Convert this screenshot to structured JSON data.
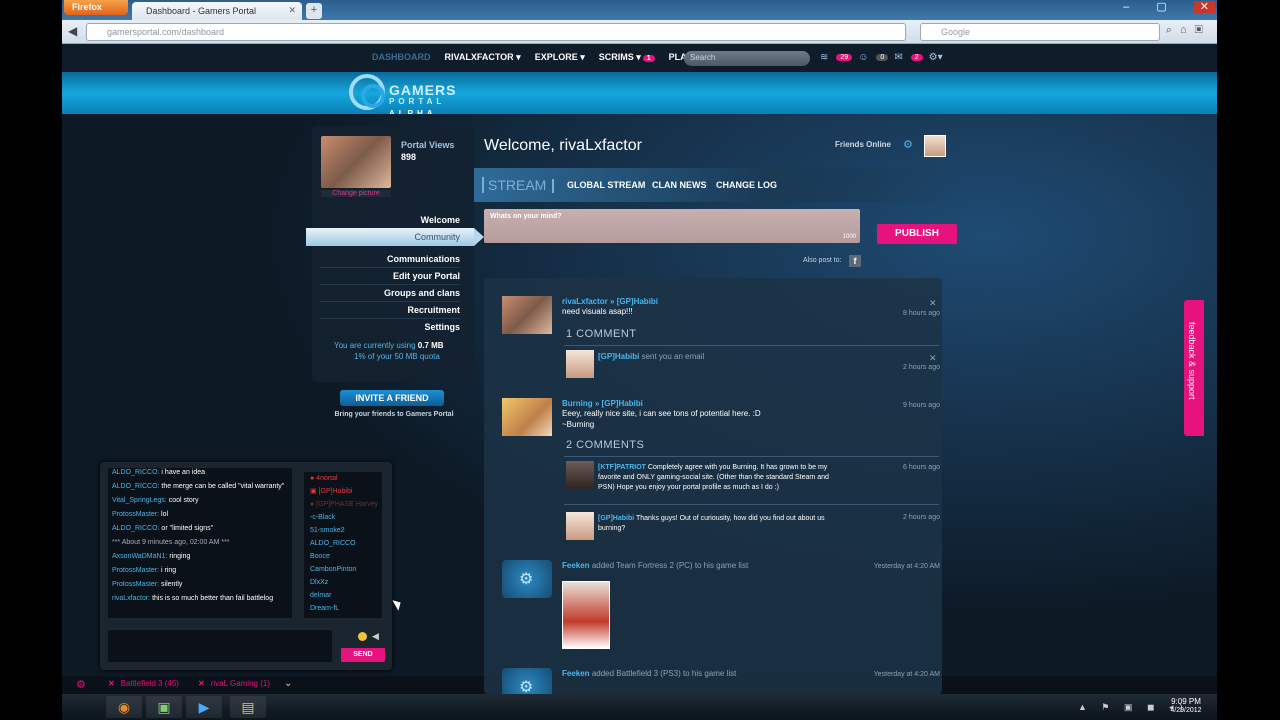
{
  "browser": {
    "app_button": "Firefox",
    "tab_title": "Dashboard - Gamers Portal",
    "new_tab": "+",
    "url": "gamersportal.com/dashboard",
    "search_placeholder": "Google",
    "win_controls": "–  ▢",
    "close": "✕"
  },
  "site_nav": {
    "dashboard": "DASHBOARD",
    "user": "RIVALXFACTOR ▾",
    "explore": "EXPLORE ▾",
    "scrims": "SCRIMS ▾",
    "scrims_badge": "1",
    "play": "PLAY",
    "search_placeholder": "Search",
    "feed_badge": "29",
    "friends_badge": "0",
    "mail_badge": "2"
  },
  "logo": {
    "line1": "GAMERS",
    "line2": "PORTAL",
    "line3": "ALPHA"
  },
  "profile": {
    "views_label": "Portal Views",
    "views_value": "898",
    "change_picture": "Change picture"
  },
  "menu": {
    "welcome": "Welcome",
    "community": "Community",
    "communications": "Communications",
    "edit_portal": "Edit your Portal",
    "groups": "Groups and clans",
    "recruitment": "Recruitment",
    "settings": "Settings"
  },
  "quota": {
    "line1_pre": "You are currently using",
    "line1_val": "0.7 MB",
    "line2_pct": "1%",
    "line2_post": "of your 50 MB quota"
  },
  "invite": {
    "button": "INVITE A FRIEND",
    "sub": "Bring your friends to Gamers Portal"
  },
  "chat": {
    "messages": [
      {
        "user": "ALDO_RICCO:",
        "text": "i have an idea"
      },
      {
        "user": "ALDO_RICCO:",
        "text": "the merge can be called \"vital warranty\""
      },
      {
        "user": "Vital_SpringLegs:",
        "text": "cool story"
      },
      {
        "user": "ProtossMaster:",
        "text": "lol"
      },
      {
        "user": "ALDO_RICCO:",
        "text": "or \"limited signs\""
      },
      {
        "user": "",
        "text": "*** About 9 minutes ago, 02:00 AM ***"
      },
      {
        "user": "AxsonWaDMaN1:",
        "text": "ringing"
      },
      {
        "user": "ProtossMaster:",
        "text": "i ring"
      },
      {
        "user": "ProtossMaster:",
        "text": "silently"
      },
      {
        "user": "rivaLxfactor:",
        "text": "this is so much better than fail battlelog"
      }
    ],
    "users": [
      {
        "name": "● 4nortal",
        "kind": "red"
      },
      {
        "name": "▣ [GP]Habibi",
        "kind": "red"
      },
      {
        "name": "● [GP]PHASE Harvey",
        "kind": "faded"
      },
      {
        "name": "-c-Black",
        "kind": "normal"
      },
      {
        "name": "51-smoke2",
        "kind": "normal"
      },
      {
        "name": "ALDO_RICCO",
        "kind": "normal"
      },
      {
        "name": "Booce",
        "kind": "normal"
      },
      {
        "name": "CambonPinton",
        "kind": "normal"
      },
      {
        "name": "DlxXz",
        "kind": "normal"
      },
      {
        "name": "delmar",
        "kind": "normal"
      },
      {
        "name": "Dream-fL",
        "kind": "normal"
      }
    ],
    "send": "SEND",
    "speaker": "◀"
  },
  "bottom_tabs": {
    "tab1": "Battlefield 3 (45)",
    "tab2": "rivaL Gaming (1)",
    "close_glyph": "✕",
    "chevron": "⌄",
    "gear": "⚙"
  },
  "main": {
    "welcome": "Welcome, rivaLxfactor",
    "friends_online": "Friends Online",
    "tabs": {
      "stream": "STREAM",
      "global": "GLOBAL STREAM",
      "clan": "CLAN NEWS",
      "changelog": "CHANGE LOG"
    },
    "status_placeholder": "Whats on your mind?",
    "status_count": "1000",
    "publish": "PUBLISH",
    "also_post": "Also post to:",
    "fb": "f"
  },
  "feed": {
    "post1": {
      "author": "rivaLxfactor » [GP]Habibi",
      "text": "need visuals asap!!!",
      "time": "8 hours ago",
      "comment_count": "1 COMMENT",
      "c1_author": "[GP]Habibi",
      "c1_text": "sent you an email",
      "c1_time": "2 hours ago"
    },
    "post2": {
      "author": "Burning » [GP]Habibi",
      "text1": "Eeey, really nice site, i can see tons of potential here. :D",
      "text2": "~Burning",
      "time": "9 hours ago",
      "comment_count": "2 COMMENTS",
      "c1_author": "[KTF]PATRIOT",
      "c1_text": "Completely agree with you Burning. It has grown to be my favorite and ONLY gaming-social site. (Other than the standard Steam and PSN) Hope you enjoy your portal profile as much as I do :)",
      "c1_time": "6 hours ago",
      "c2_author": "[GP]Habibi",
      "c2_text": "Thanks guys! Out of curiousity, how did you find out about us burning?",
      "c2_time": "2 hours ago"
    },
    "post3": {
      "author": "Feeken",
      "text": "added Team Fortress 2 (PC) to his game list",
      "time": "Yesterday at 4:20 AM"
    },
    "post4": {
      "author": "Feeken",
      "text": "added Battlefield 3 (PS3) to his game list",
      "time": "Yesterday at 4:20 AM"
    },
    "close_glyph": "✕"
  },
  "feedback": "feedback & support",
  "taskbar": {
    "time": "9:09 PM",
    "date": "4/29/2012",
    "tray": "▲ ⚑ ▣ ◼ ◂)"
  }
}
